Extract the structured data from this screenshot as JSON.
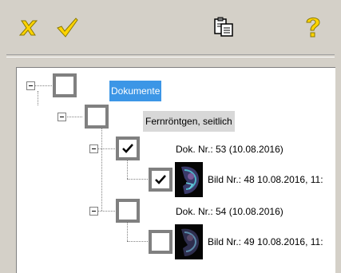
{
  "toolbar": {
    "cancel_icon": "x-icon",
    "confirm_icon": "checkmark-icon",
    "clipboard_icon": "paste-clipboard-icon",
    "help_icon": "question-mark-icon",
    "accent": "#ffd400"
  },
  "tree": {
    "root_label": "Dokumente",
    "group_label": "Fernröntgen, seitlich",
    "doc1_label": "Dok. Nr.:  53  (10.08.2016)",
    "img1_label": "Bild Nr.:  48 10.08.2016, 11:",
    "doc2_label": "Dok. Nr.:  54  (10.08.2016)",
    "img2_label": "Bild Nr.:  49 10.08.2016, 11:",
    "doc1_checked": true,
    "img1_checked": true,
    "doc2_checked": false,
    "img2_checked": false
  }
}
